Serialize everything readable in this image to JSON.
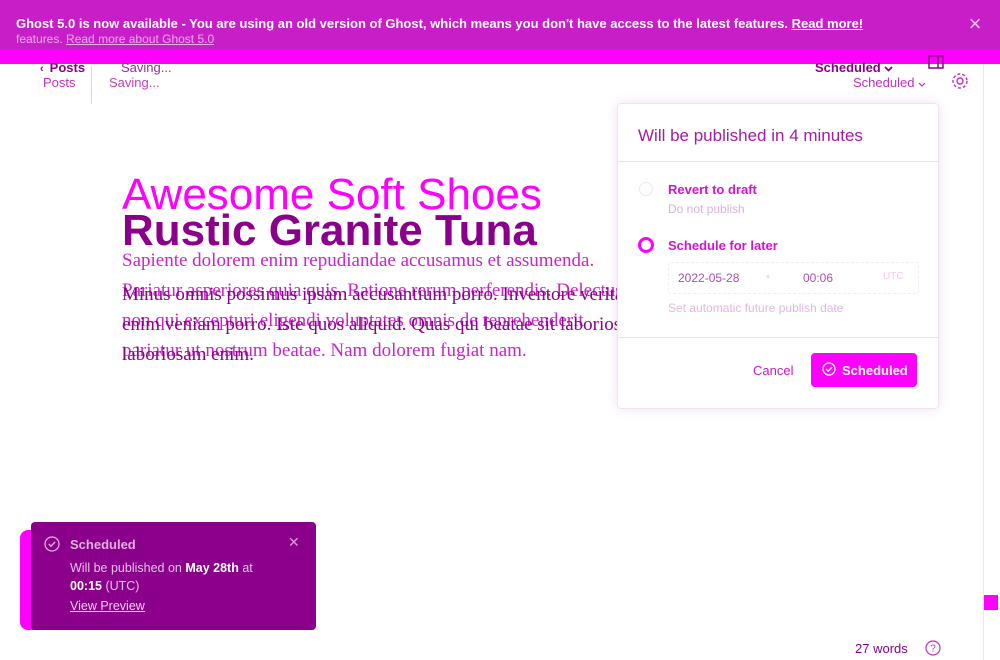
{
  "banner": {
    "message": "Ghost 5.0 is now available - You are using an old version of Ghost, which means you don't have access to the latest features.",
    "link_label": "Read more!",
    "ghost_line": "features.",
    "ghost_link": "Read more about Ghost 5.0",
    "close_icon": "close-icon"
  },
  "header": {
    "back_label": "Posts",
    "back_shadow": "Posts",
    "saving_label": "Saving...",
    "saving_shadow": "Saving...",
    "status_label": "Scheduled",
    "status_shadow": "Scheduled"
  },
  "editor": {
    "title_ghost": "Awesome Soft Shoes",
    "title": "Rustic Granite Tuna",
    "body_ghost": "Sapiente dolorem enim repudiandae accusamus et assumenda. Pariatur asperiores quia quis. Ratione rerum perferendis. Delectus non qui excepturi eligendi voluptates omnis de reprehenderit pariatur ut nostrum beatae. Nam dolorem fugiat nam.",
    "body": "Minus omnis possimus ipsam accusantium porro. Inventore veritatis non nulla quis tempore enim veniam porro. Iste quos aliquid. Quas qui beatae sit laboriosam. Delectus atque laboriosam enim."
  },
  "publish_menu": {
    "title": "Will be published in 4 minutes",
    "revert_label": "Revert to draft",
    "revert_desc": "Do not publish",
    "schedule_label": "Schedule for later",
    "date": "2022-05-28",
    "time": "00:06",
    "timezone": "UTC",
    "hint": "Set automatic future publish date",
    "cancel_label": "Cancel",
    "confirm_label": "Scheduled",
    "selected_option": "schedule"
  },
  "toast": {
    "title": "Scheduled",
    "message_prefix": "Will be published on ",
    "date_bold": "May 28th",
    "message_mid": " at ",
    "time_bold": "00:15",
    "message_suffix": " (UTC)",
    "link_label": "View Preview"
  },
  "footer": {
    "word_count": "27 words"
  },
  "colors": {
    "accent": "#ff00ff",
    "text": "#8a008a",
    "banner": "#c81ec8"
  }
}
